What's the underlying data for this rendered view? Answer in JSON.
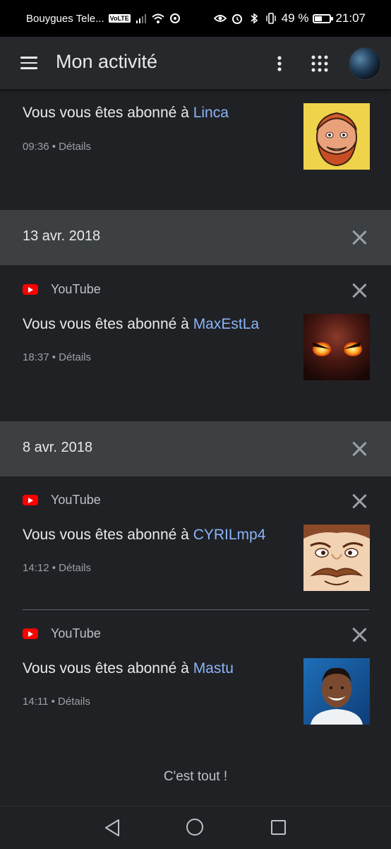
{
  "status_bar": {
    "carrier": "Bouygues Tele...",
    "network_badge": "VoLTE",
    "battery": "49 %",
    "battery_level": 0.49,
    "time": "21:07"
  },
  "app_bar": {
    "title": "Mon activité",
    "menu_icon": "hamburger-menu-icon",
    "more_icon": "more-vert-icon",
    "apps_icon": "apps-grid-icon"
  },
  "sections": [
    {
      "date": "",
      "items": [
        {
          "source": "",
          "prefix": "Vous vous êtes abonné à ",
          "channel": "Linca",
          "time": "09:36",
          "details": "Détails",
          "separator": " • "
        }
      ]
    },
    {
      "date": "13 avr. 2018",
      "items": [
        {
          "source": "YouTube",
          "prefix": "Vous vous êtes abonné à ",
          "channel": "MaxEstLa",
          "time": "18:37",
          "details": "Détails",
          "separator": " • "
        }
      ]
    },
    {
      "date": "8 avr. 2018",
      "items": [
        {
          "source": "YouTube",
          "prefix": "Vous vous êtes abonné à ",
          "channel": "CYRILmp4",
          "time": "14:12",
          "details": "Détails",
          "separator": " • "
        },
        {
          "source": "YouTube",
          "prefix": "Vous vous êtes abonné à ",
          "channel": "Mastu",
          "time": "14:11",
          "details": "Détails",
          "separator": " • "
        }
      ]
    }
  ],
  "end_message": "C'est tout !",
  "colors": {
    "link": "#8ab4f8",
    "background": "#202124",
    "date_header": "#3c4043",
    "youtube_red": "#ff0000"
  }
}
